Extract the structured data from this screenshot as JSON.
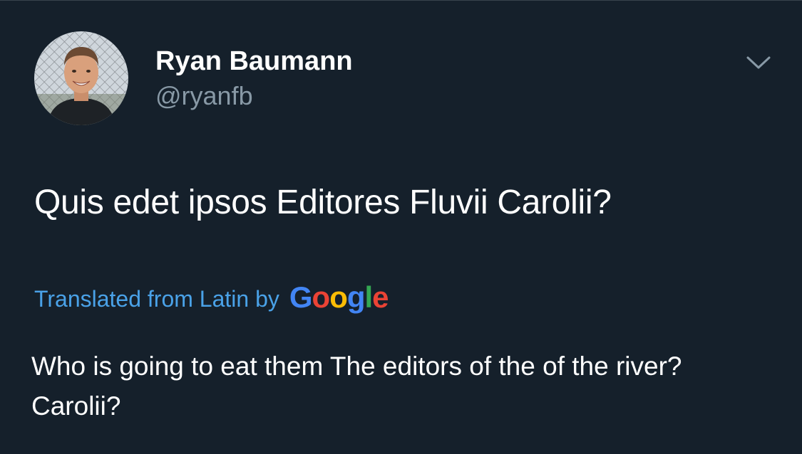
{
  "author": {
    "display_name": "Ryan Baumann",
    "handle": "@ryanfb"
  },
  "menu": {
    "icon": "chevron-down-icon"
  },
  "tweet": {
    "text": "Quis edet ipsos Editores Fluvii Carolii?"
  },
  "translation": {
    "label": "Translated from Latin by",
    "provider": {
      "letters": [
        "G",
        "o",
        "o",
        "g",
        "l",
        "e"
      ],
      "colors": [
        "#4285f4",
        "#ea4335",
        "#fbbc05",
        "#4285f4",
        "#34a853",
        "#ea4335"
      ]
    },
    "text": "Who is going to eat them The editors of the of the river? Carolii?"
  },
  "colors": {
    "background": "#15202b",
    "secondary_text": "#8899a6",
    "link": "#4aa2e8",
    "primary_text": "#ffffff"
  }
}
